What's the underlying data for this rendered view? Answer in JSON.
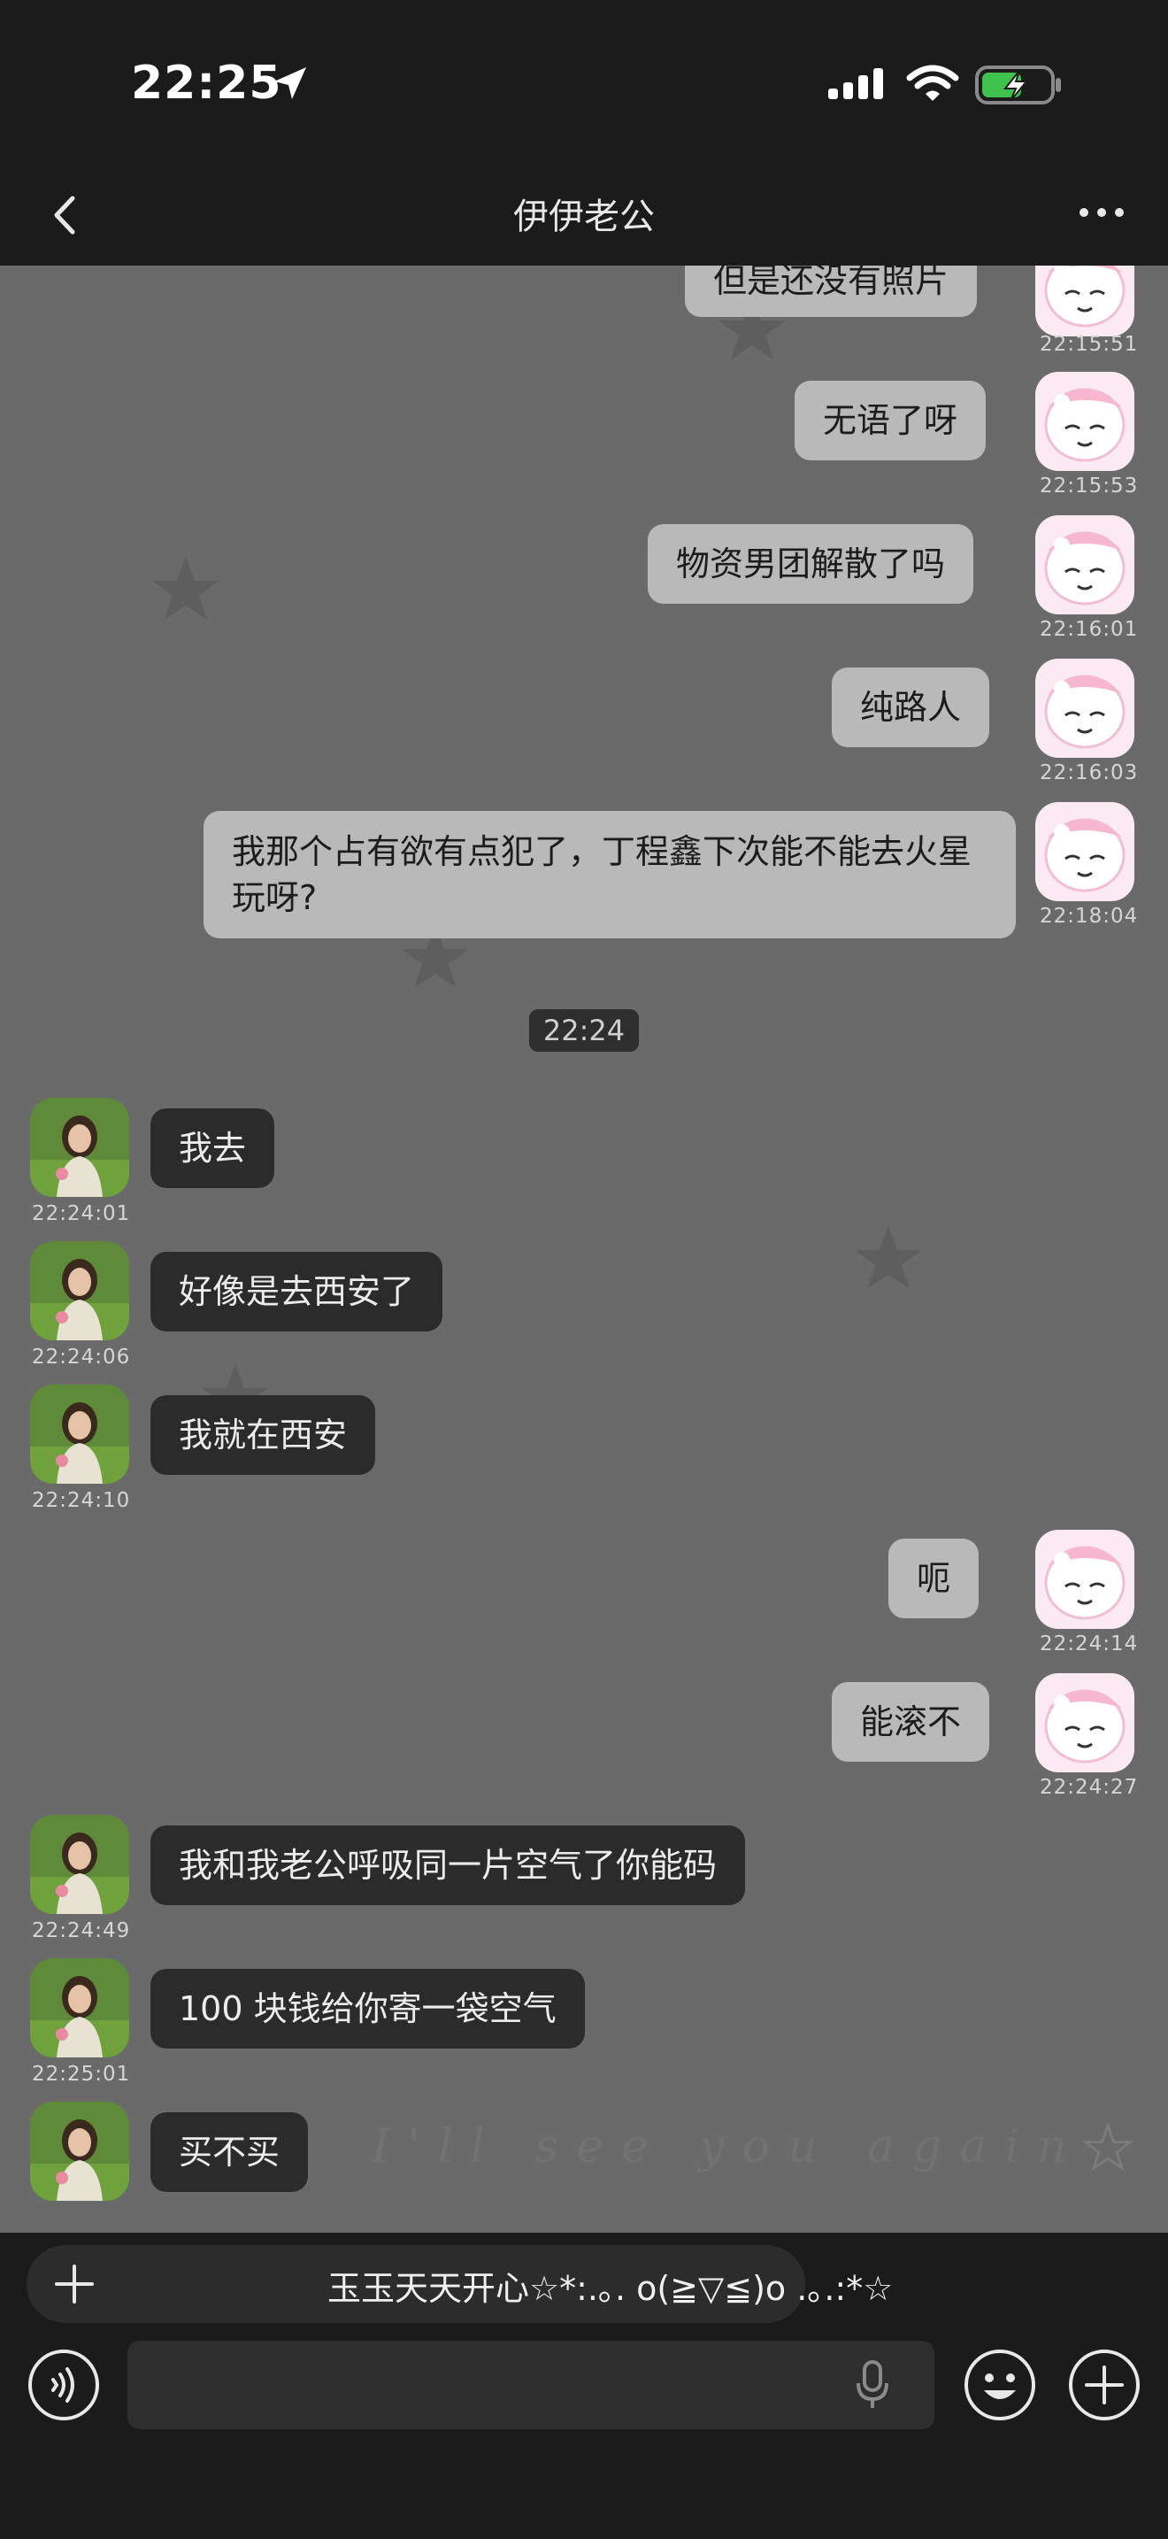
{
  "status_bar": {
    "time": "22:25",
    "icons": [
      "location-arrow-icon",
      "cellular-signal-icon",
      "wifi-icon",
      "battery-charging-icon"
    ]
  },
  "nav": {
    "title": "伊伊老公",
    "back_icon": "chevron-left-icon",
    "more_icon": "more-dots-icon"
  },
  "messages": [
    {
      "side": "out",
      "text": "但是还没有照片",
      "time": "22:15:51"
    },
    {
      "side": "out",
      "text": "无语了呀",
      "time": "22:15:53"
    },
    {
      "side": "out",
      "text": "物资男团解散了吗",
      "time": "22:16:01"
    },
    {
      "side": "out",
      "text": "纯路人",
      "time": "22:16:03"
    },
    {
      "side": "out",
      "text": "我那个占有欲有点犯了，丁程鑫下次能不能去火星玩呀?",
      "time": "22:18:04"
    },
    {
      "side": "in",
      "text": "我去",
      "time": "22:24:01"
    },
    {
      "side": "in",
      "text": "好像是去西安了",
      "time": "22:24:06"
    },
    {
      "side": "in",
      "text": "我就在西安",
      "time": "22:24:10"
    },
    {
      "side": "out",
      "text": "呃",
      "time": "22:24:14"
    },
    {
      "side": "out",
      "text": "能滚不",
      "time": "22:24:27"
    },
    {
      "side": "in",
      "text": "我和我老公呼吸同一片空气了你能码",
      "time": "22:24:49"
    },
    {
      "side": "in",
      "text": "100 块钱给你寄一袋空气",
      "time": "22:25:01"
    },
    {
      "side": "in",
      "text": "买不买",
      "time": ""
    }
  ],
  "center_time": "22:24",
  "background_text": "I'll see you again",
  "quick_bar": {
    "text": "玉玉天天开心☆*:.｡. o(≧▽≦)o .｡.:*☆"
  },
  "input": {
    "placeholder": ""
  },
  "colors": {
    "outgoing_bubble": "#b9b9b9",
    "incoming_bubble": "#2b2b2b",
    "chat_bg": "#6a6a6a",
    "bars": "#1b1b1b"
  }
}
